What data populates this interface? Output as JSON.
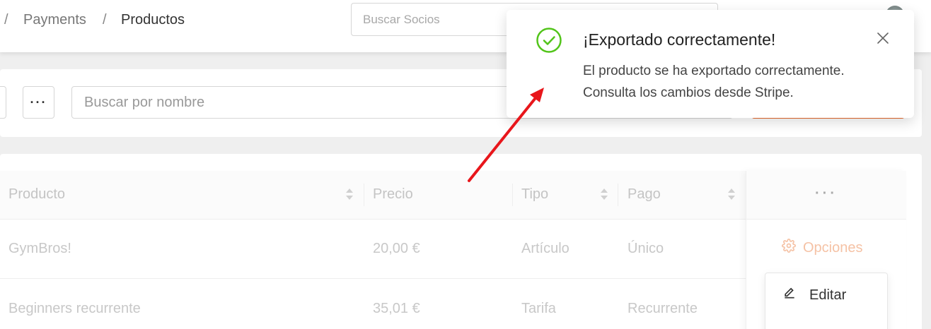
{
  "breadcrumb": {
    "sep1": "/",
    "payments": "Payments",
    "sep2": "/",
    "current": "Productos"
  },
  "header": {
    "search_placeholder": "Buscar Socios"
  },
  "toolbar": {
    "more_label": "···",
    "search_placeholder": "Buscar por nombre"
  },
  "table": {
    "columns": [
      "Producto",
      "Precio",
      "Tipo",
      "Pago"
    ],
    "options_header": "···",
    "rows": [
      {
        "producto": "GymBros!",
        "precio": "20,00 €",
        "tipo": "Artículo",
        "pago": "Único"
      },
      {
        "producto": "Beginners recurrente",
        "precio": "35,01 €",
        "tipo": "Tarifa",
        "pago": "Recurrente"
      }
    ],
    "options_label": "Opciones"
  },
  "menu": {
    "edit_label": "Editar"
  },
  "toast": {
    "title": "¡Exportado correctamente!",
    "line1": "El producto se ha exportado correctamente.",
    "line2": "Consulta los cambios desde Stripe."
  },
  "colors": {
    "accent_orange": "#ec6a2b",
    "success_green": "#52c41a",
    "annotation_red": "#e8161b"
  }
}
